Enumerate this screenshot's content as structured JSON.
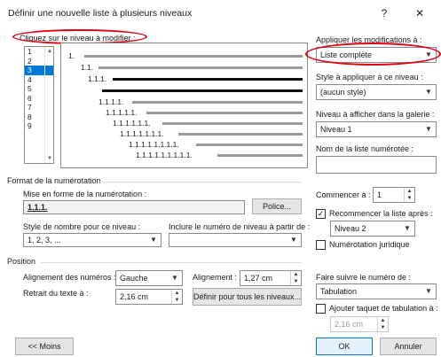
{
  "window": {
    "title": "Définir une nouvelle liste à plusieurs niveaux",
    "help_glyph": "?",
    "close_glyph": "✕"
  },
  "levels": {
    "label": "Cliquez sur le niveau à modifier :",
    "items": [
      "1",
      "2",
      "3",
      "4",
      "5",
      "6",
      "7",
      "8",
      "9"
    ],
    "selected_index": 2
  },
  "preview": {
    "rows": [
      {
        "text": "1."
      },
      {
        "text": "1.1."
      },
      {
        "text": "1.1.1."
      },
      {
        "text": ""
      },
      {
        "text": "1.1.1.1."
      },
      {
        "text": "1.1.1.1.1."
      },
      {
        "text": "1.1.1.1.1.1."
      },
      {
        "text": "1.1.1.1.1.1.1."
      },
      {
        "text": "1.1.1.1.1.1.1.1."
      },
      {
        "text": "1.1.1.1.1.1.1.1.1."
      }
    ]
  },
  "right_panel": {
    "apply_label": "Appliquer les modifications à :",
    "apply_value": "Liste complète",
    "style_label": "Style à appliquer à ce niveau :",
    "style_value": "(aucun style)",
    "gallery_label": "Niveau à afficher dans la galerie :",
    "gallery_value": "Niveau 1",
    "listname_label": "Nom de la liste numérotée :",
    "listname_value": ""
  },
  "format": {
    "section_label": "Format de la numérotation",
    "mise_label": "Mise en forme de la numérotation :",
    "mise_value": "1.1.1.",
    "police_button": "Police...",
    "style_nombre_label": "Style de nombre pour ce niveau :",
    "style_nombre_value": "1, 2, 3, ...",
    "inclure_label": "Inclure le numéro de niveau à partir de :",
    "inclure_value": "",
    "commencer_label": "Commencer à :",
    "commencer_value": "1",
    "recommencer_label": "Recommencer la liste après :",
    "recommencer_checked": true,
    "recommencer_value": "Niveau 2",
    "juridique_label": "Numérotation juridique",
    "juridique_checked": false
  },
  "position": {
    "section_label": "Position",
    "alignement_num_label": "Alignement des numéros :",
    "alignement_num_value": "Gauche",
    "alignement_label": "Alignement :",
    "alignement_value": "1,27 cm",
    "retrait_label": "Retrait du texte à :",
    "retrait_value": "2,16 cm",
    "definir_button": "Définir pour tous les niveaux...",
    "suivre_label": "Faire suivre le numéro de :",
    "suivre_value": "Tabulation",
    "taquet_label": "Ajouter taquet de tabulation à :",
    "taquet_checked": false,
    "taquet_value": "2,16 cm"
  },
  "footer": {
    "moins_button": "<< Moins",
    "ok_button": "OK",
    "annuler_button": "Annuler"
  },
  "colors": {
    "annotation": "#e3000f",
    "selection": "#0078d7"
  }
}
